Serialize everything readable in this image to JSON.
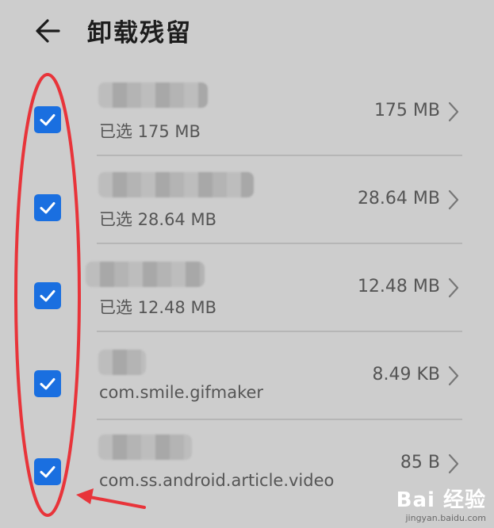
{
  "header": {
    "back_icon": "arrow-left-icon",
    "title": "卸载残留"
  },
  "items": [
    {
      "subtitle": "已选 175 MB",
      "size": "175 MB",
      "checked": true
    },
    {
      "subtitle": "已选 28.64 MB",
      "size": "28.64 MB",
      "checked": true
    },
    {
      "subtitle": "已选 12.48 MB",
      "size": "12.48 MB",
      "checked": true
    },
    {
      "subtitle": "com.smile.gifmaker",
      "size": "8.49 KB",
      "checked": true
    },
    {
      "subtitle": "com.ss.android.article.video",
      "size": "85 B",
      "checked": true
    }
  ],
  "colors": {
    "checkbox": "#1a6fe0",
    "annotation": "#e8343a",
    "background": "#cdcdcd"
  },
  "watermark": {
    "brand": "Bai 经验",
    "url": "jingyan.baidu.com"
  }
}
